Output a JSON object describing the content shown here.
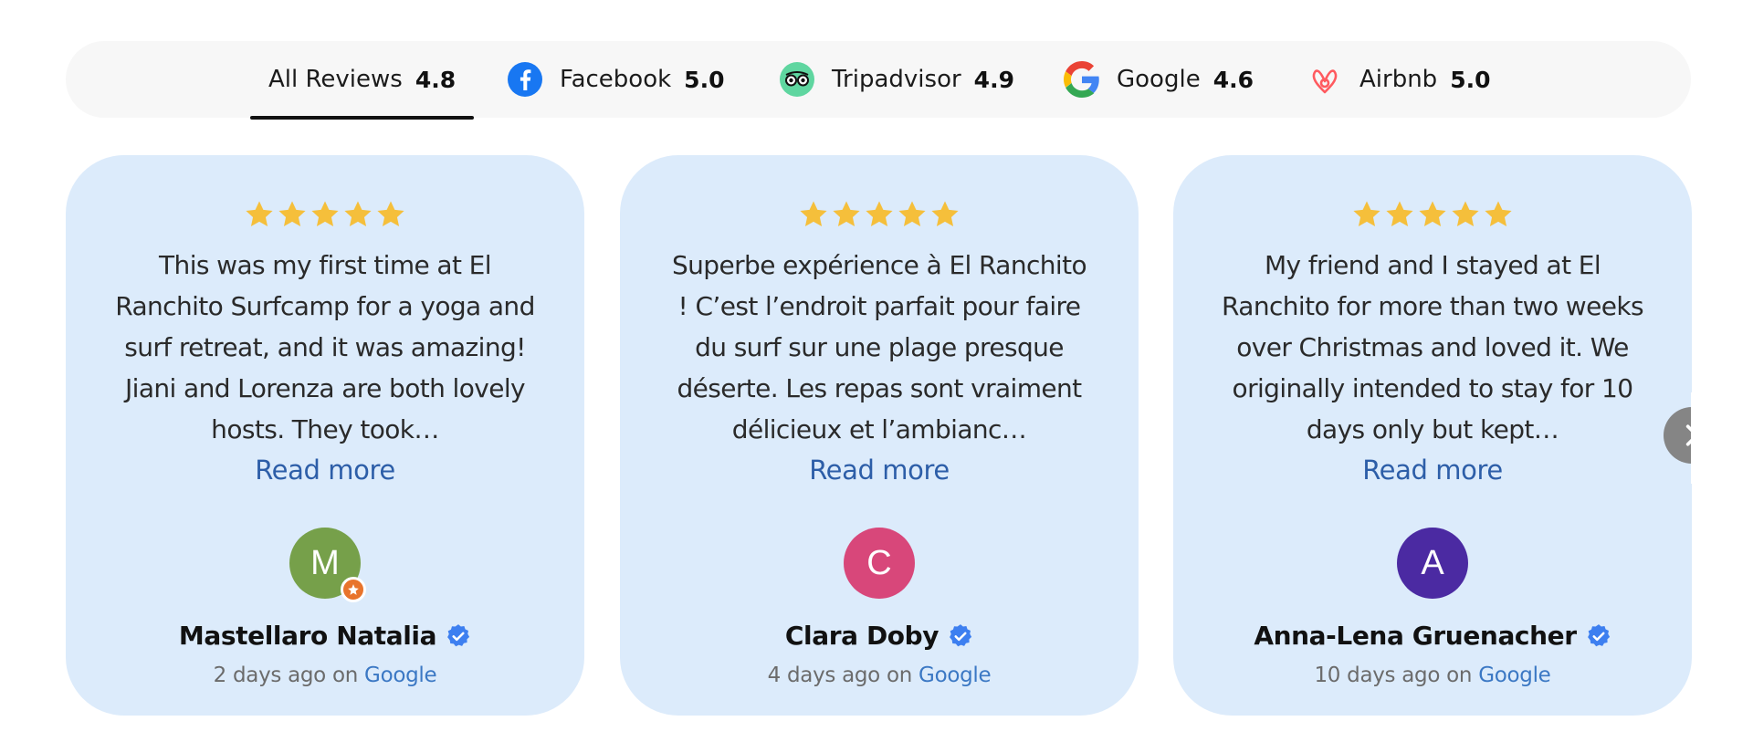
{
  "tabs": [
    {
      "label": "All Reviews",
      "score": "4.8",
      "icon": "none",
      "active": true
    },
    {
      "label": "Facebook",
      "score": "5.0",
      "icon": "facebook-icon"
    },
    {
      "label": "Tripadvisor",
      "score": "4.9",
      "icon": "tripadvisor-icon"
    },
    {
      "label": "Google",
      "score": "4.6",
      "icon": "google-icon"
    },
    {
      "label": "Airbnb",
      "score": "5.0",
      "icon": "airbnb-icon"
    }
  ],
  "reviews": [
    {
      "rating": 5,
      "text": "This was my first time at El Ranchito Surfcamp for a yoga and surf retreat, and it was amazing! Jiani and Lorenza are both lovely hosts. They took…",
      "read_more": "Read more",
      "avatar_letter": "M",
      "avatar_color": "#76a04a",
      "name": "Mastellaro Natalia",
      "time": "2 days ago",
      "on": "on",
      "source": "Google"
    },
    {
      "rating": 5,
      "text": "Superbe expérience à El Ranchito ! C’est l’endroit parfait pour faire du surf sur une plage presque déserte. Les repas sont vraiment délicieux et l’ambianc…",
      "read_more": "Read more",
      "avatar_letter": "C",
      "avatar_color": "#d8477a",
      "name": "Clara Doby",
      "time": "4 days ago",
      "on": "on",
      "source": "Google"
    },
    {
      "rating": 5,
      "text": "My friend and I stayed at El Ranchito for more than two weeks over Christmas and loved it. We originally intended to stay for 10 days only but kept…",
      "read_more": "Read more",
      "avatar_letter": "A",
      "avatar_color": "#4b2aa2",
      "name": "Anna-Lena Gruenacher",
      "time": "10 days ago",
      "on": "on",
      "source": "Google"
    }
  ],
  "colors": {
    "star": "#f5bf3b",
    "card_bg": "#dcebfb",
    "link": "#2d5ea8",
    "verified": "#3d7ff0"
  }
}
